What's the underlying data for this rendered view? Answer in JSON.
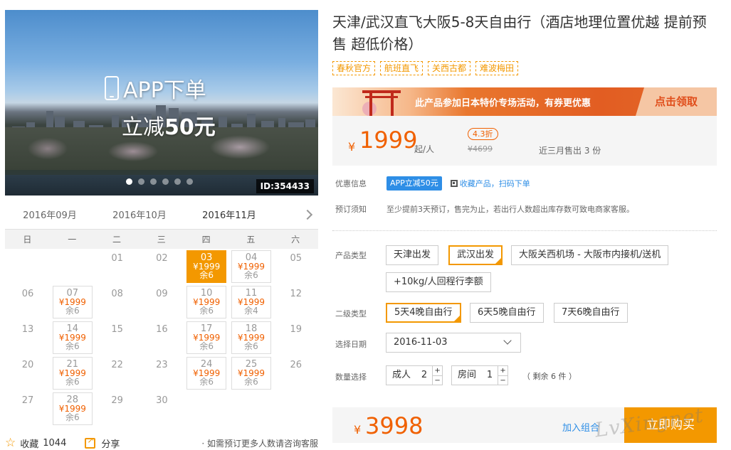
{
  "banner": {
    "promo_line1": "APP下单",
    "promo_line2_prefix": "立减",
    "promo_line2_amount": "50元",
    "image_id": "ID:354433",
    "dots": 6,
    "active_dot": 0
  },
  "calendar": {
    "months": [
      "2016年09月",
      "2016年10月",
      "2016年11月"
    ],
    "active_month": 2,
    "weekdays": [
      "日",
      "一",
      "二",
      "三",
      "四",
      "五",
      "六"
    ],
    "weeks": [
      [
        null,
        null,
        {
          "d": "01"
        },
        {
          "d": "02"
        },
        {
          "d": "03",
          "p": "¥1999",
          "r": "余6",
          "sel": true
        },
        {
          "d": "04",
          "p": "¥1999",
          "r": "余6"
        },
        {
          "d": "05"
        }
      ],
      [
        {
          "d": "06"
        },
        {
          "d": "07",
          "p": "¥1999",
          "r": "余6"
        },
        {
          "d": "08"
        },
        {
          "d": "09"
        },
        {
          "d": "10",
          "p": "¥1999",
          "r": "余6"
        },
        {
          "d": "11",
          "p": "¥1999",
          "r": "余4"
        },
        {
          "d": "12"
        }
      ],
      [
        {
          "d": "13"
        },
        {
          "d": "14",
          "p": "¥1999",
          "r": "余6"
        },
        {
          "d": "15"
        },
        {
          "d": "16"
        },
        {
          "d": "17",
          "p": "¥1999",
          "r": "余6"
        },
        {
          "d": "18",
          "p": "¥1999",
          "r": "余6"
        },
        {
          "d": "19"
        }
      ],
      [
        {
          "d": "20"
        },
        {
          "d": "21",
          "p": "¥1999",
          "r": "余6"
        },
        {
          "d": "22"
        },
        {
          "d": "23"
        },
        {
          "d": "24",
          "p": "¥1999",
          "r": "余6"
        },
        {
          "d": "25",
          "p": "¥1999",
          "r": "余6"
        },
        {
          "d": "26"
        }
      ],
      [
        {
          "d": "27"
        },
        {
          "d": "28",
          "p": "¥1999",
          "r": "余6"
        },
        {
          "d": "29"
        },
        {
          "d": "30"
        },
        null,
        null,
        null
      ]
    ]
  },
  "footer_left": {
    "favorite_label": "收藏",
    "favorite_count": "1044",
    "share_label": "分享",
    "note": "· 如需预订更多人数请咨询客服"
  },
  "product": {
    "title": "天津/武汉直飞大阪5-8天自由行（酒店地理位置优越 提前预售 超低价格）",
    "tags": [
      "春秋官方",
      "航班直飞",
      "关西古都",
      "难波梅田"
    ],
    "promo_message": "此产品参加日本特价专场活动，有券更优惠",
    "promo_button": "点击领取",
    "price_symbol": "¥",
    "price": "1999",
    "price_suffix": "起/人",
    "discount": "4.3折",
    "original_price": "¥4699",
    "sold_text": "近三月售出 3 份"
  },
  "info": {
    "discount_label": "优惠信息",
    "discount_badge": "APP立减50元",
    "qr_text": "收藏产品，扫码下单",
    "booking_label": "预订须知",
    "booking_text": "至少提前3天预订，售完为止，若出行人数超出库存数可致电商家客服。"
  },
  "options": {
    "product_type_label": "产品类型",
    "product_types": [
      "天津出发",
      "武汉出发",
      "大阪关西机场 - 大阪市内接机/送机",
      "+10kg/人回程行李额"
    ],
    "product_type_selected": 1,
    "sub_type_label": "二级类型",
    "sub_types": [
      "5天4晚自由行",
      "6天5晚自由行",
      "7天6晚自由行"
    ],
    "sub_type_selected": 0,
    "date_label": "选择日期",
    "date_value": "2016-11-03",
    "qty_label": "数量选择",
    "adult_label": "成人",
    "adult_value": "2",
    "room_label": "房间",
    "room_value": "1",
    "plus": "+",
    "minus": "−",
    "remaining": "（ 剩余 6 件 ）"
  },
  "buy": {
    "price_symbol": "¥",
    "total": "3998",
    "combo_label": "加入组合",
    "buy_label": "立即购买"
  },
  "watermark": "LvXingnet"
}
